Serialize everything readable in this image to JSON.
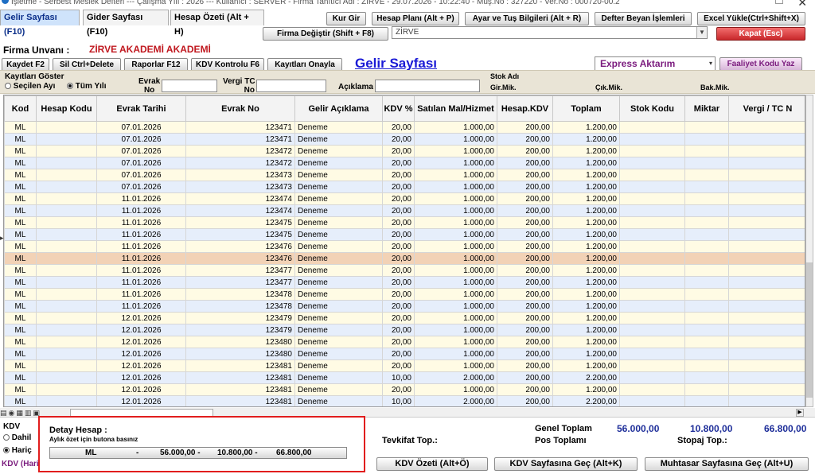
{
  "title_bar": "İşletme - Serbest Meslek Defteri --- Çalışma Yılı : 2026 --- Kullanıcı : SERVER - Firma Tanıtıcı Adı : ZİRVE - 29.07.2026 - 10:22:40 - Müş.No : 327220 - Ver.No : 000720-00.2",
  "tabs": [
    "Gelir Sayfası (F10)",
    "Gider Sayfası (F10)",
    "Hesap Özeti (Alt + H)"
  ],
  "top_buttons": {
    "kur_gir": "Kur Gir",
    "hesap_plani": "Hesap Planı (Alt + P)",
    "ayar": "Ayar ve Tuş Bilgileri (Alt + R)",
    "defter_beyan": "Defter Beyan İşlemleri",
    "excel_yukle": "Excel Yükle(Ctrl+Shift+X)",
    "firma_degistir": "Firma Değiştir (Shift + F8)",
    "kapat": "Kapat (Esc)"
  },
  "firma_combo_value": "ZİRVE",
  "firma_unvani_label": "Firma Unvanı :",
  "firma_unvani_value": "ZİRVE AKADEMİ AKADEMİ",
  "toolbar": {
    "kaydet": "Kaydet F2",
    "sil": "Sil Ctrl+Delete",
    "raporlar": "Raporlar F12",
    "kdv_kontrolu": "KDV Kontrolu F6",
    "kayitlari_onayla": "Kayıtları Onayla"
  },
  "page_title": "Gelir Sayfası",
  "express_combo": "Express Aktarım",
  "faaliyet_button": "Faaliyet Kodu Yaz",
  "filters": {
    "kayitlari_goster": "Kayıtları Göster",
    "secilen_ayi": "Seçilen Ayı",
    "tum_yili": "Tüm Yılı",
    "evrak_no_1": "Evrak",
    "evrak_no_2": "No",
    "vergi_tc_1": "Vergi TC",
    "vergi_tc_2": "No",
    "aciklama": "Açıklama",
    "stok_adi": "Stok Adı",
    "gir_mik": "Gir.Mik.",
    "cik_mik": "Çık.Mik.",
    "bak_mik": "Bak.Mik."
  },
  "columns": [
    "Kod",
    "Hesap Kodu",
    "Evrak Tarihi",
    "Evrak No",
    "Gelir Açıklama",
    "KDV %",
    "Satılan Mal/Hizmet",
    "Hesap.KDV",
    "Toplam",
    "Stok Kodu",
    "Miktar",
    "Vergi / TC N"
  ],
  "rows": [
    [
      "ML",
      "",
      "07.01.2026",
      "123471",
      "Deneme",
      "20,00",
      "1.000,00",
      "200,00",
      "1.200,00",
      "",
      "",
      ""
    ],
    [
      "ML",
      "",
      "07.01.2026",
      "123471",
      "Deneme",
      "20,00",
      "1.000,00",
      "200,00",
      "1.200,00",
      "",
      "",
      ""
    ],
    [
      "ML",
      "",
      "07.01.2026",
      "123472",
      "Deneme",
      "20,00",
      "1.000,00",
      "200,00",
      "1.200,00",
      "",
      "",
      ""
    ],
    [
      "ML",
      "",
      "07.01.2026",
      "123472",
      "Deneme",
      "20,00",
      "1.000,00",
      "200,00",
      "1.200,00",
      "",
      "",
      ""
    ],
    [
      "ML",
      "",
      "07.01.2026",
      "123473",
      "Deneme",
      "20,00",
      "1.000,00",
      "200,00",
      "1.200,00",
      "",
      "",
      ""
    ],
    [
      "ML",
      "",
      "07.01.2026",
      "123473",
      "Deneme",
      "20,00",
      "1.000,00",
      "200,00",
      "1.200,00",
      "",
      "",
      ""
    ],
    [
      "ML",
      "",
      "11.01.2026",
      "123474",
      "Deneme",
      "20,00",
      "1.000,00",
      "200,00",
      "1.200,00",
      "",
      "",
      ""
    ],
    [
      "ML",
      "",
      "11.01.2026",
      "123474",
      "Deneme",
      "20,00",
      "1.000,00",
      "200,00",
      "1.200,00",
      "",
      "",
      ""
    ],
    [
      "ML",
      "",
      "11.01.2026",
      "123475",
      "Deneme",
      "20,00",
      "1.000,00",
      "200,00",
      "1.200,00",
      "",
      "",
      ""
    ],
    [
      "ML",
      "",
      "11.01.2026",
      "123475",
      "Deneme",
      "20,00",
      "1.000,00",
      "200,00",
      "1.200,00",
      "",
      "",
      ""
    ],
    [
      "ML",
      "",
      "11.01.2026",
      "123476",
      "Deneme",
      "20,00",
      "1.000,00",
      "200,00",
      "1.200,00",
      "",
      "",
      ""
    ],
    [
      "ML",
      "",
      "11.01.2026",
      "123476",
      "Deneme",
      "20,00",
      "1.000,00",
      "200,00",
      "1.200,00",
      "",
      "",
      ""
    ],
    [
      "ML",
      "",
      "11.01.2026",
      "123477",
      "Deneme",
      "20,00",
      "1.000,00",
      "200,00",
      "1.200,00",
      "",
      "",
      ""
    ],
    [
      "ML",
      "",
      "11.01.2026",
      "123477",
      "Deneme",
      "20,00",
      "1.000,00",
      "200,00",
      "1.200,00",
      "",
      "",
      ""
    ],
    [
      "ML",
      "",
      "11.01.2026",
      "123478",
      "Deneme",
      "20,00",
      "1.000,00",
      "200,00",
      "1.200,00",
      "",
      "",
      ""
    ],
    [
      "ML",
      "",
      "11.01.2026",
      "123478",
      "Deneme",
      "20,00",
      "1.000,00",
      "200,00",
      "1.200,00",
      "",
      "",
      ""
    ],
    [
      "ML",
      "",
      "12.01.2026",
      "123479",
      "Deneme",
      "20,00",
      "1.000,00",
      "200,00",
      "1.200,00",
      "",
      "",
      ""
    ],
    [
      "ML",
      "",
      "12.01.2026",
      "123479",
      "Deneme",
      "20,00",
      "1.000,00",
      "200,00",
      "1.200,00",
      "",
      "",
      ""
    ],
    [
      "ML",
      "",
      "12.01.2026",
      "123480",
      "Deneme",
      "20,00",
      "1.000,00",
      "200,00",
      "1.200,00",
      "",
      "",
      ""
    ],
    [
      "ML",
      "",
      "12.01.2026",
      "123480",
      "Deneme",
      "20,00",
      "1.000,00",
      "200,00",
      "1.200,00",
      "",
      "",
      ""
    ],
    [
      "ML",
      "",
      "12.01.2026",
      "123481",
      "Deneme",
      "20,00",
      "1.000,00",
      "200,00",
      "1.200,00",
      "",
      "",
      ""
    ],
    [
      "ML",
      "",
      "12.01.2026",
      "123481",
      "Deneme",
      "10,00",
      "2.000,00",
      "200,00",
      "2.200,00",
      "",
      "",
      ""
    ],
    [
      "ML",
      "",
      "12.01.2026",
      "123481",
      "Deneme",
      "20,00",
      "1.000,00",
      "200,00",
      "1.200,00",
      "",
      "",
      ""
    ],
    [
      "ML",
      "",
      "12.01.2026",
      "123481",
      "Deneme",
      "10,00",
      "2.000,00",
      "200,00",
      "2.200,00",
      "",
      "",
      ""
    ]
  ],
  "selected_row_index": 11,
  "kdv_group": {
    "label": "KDV",
    "dahil": "Dahil",
    "haric": "Hariç",
    "status": "KDV (Hariç)"
  },
  "detay": {
    "title": "Detay Hesap :",
    "hint": "Aylık özet için butona basınız",
    "kod": "ML",
    "dash": "-",
    "v1": "56.000,00 -",
    "v2": "10.800,00 -",
    "v3": "66.800,00"
  },
  "totals": {
    "tevkifat": "Tevkifat Top.:",
    "genel_toplam": "Genel Toplam",
    "pos_toplami": "Pos Toplamı",
    "stopaj": "Stopaj  Top.:",
    "val_matrah": "56.000,00",
    "val_kdv": "10.800,00",
    "val_toplam": "66.800,00"
  },
  "bottom_buttons": {
    "kdv_ozeti": "KDV Özeti (Alt+Ö)",
    "kdv_sayfasina": "KDV Sayfasına Geç (Alt+K)",
    "muhtasar": "Muhtasar Sayfasına Geç (Alt+U)"
  },
  "colors": {
    "accent_blue": "#1f2f9a",
    "title_red": "#c0181f",
    "express_purple": "#7b1c7e",
    "selected_row": "#f2d2b6",
    "highlight_box": "#e11d1d"
  }
}
